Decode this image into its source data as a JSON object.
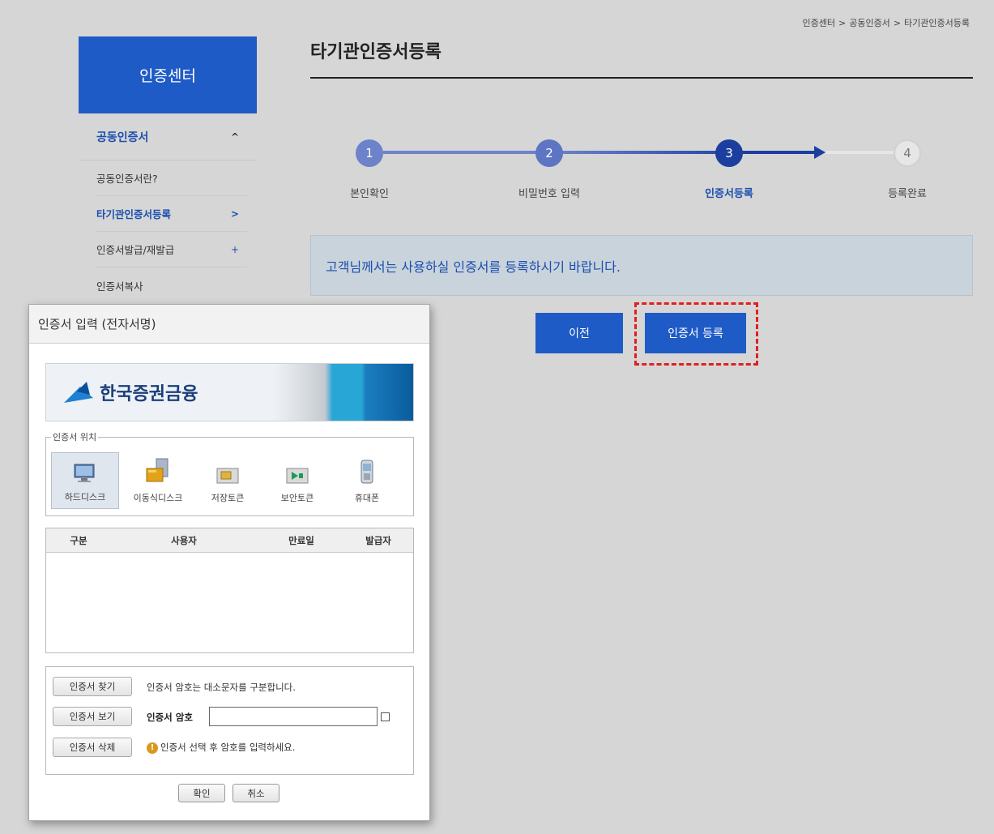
{
  "breadcrumb": [
    "인증센터",
    "공동인증서",
    "타기관인증서등록"
  ],
  "breadcrumb_separator": ">",
  "sidebar": {
    "title": "인증센터",
    "section": "공동인증서",
    "section_toggle": "^",
    "items": [
      {
        "label": "공동인증서란?",
        "mark": ""
      },
      {
        "label": "타기관인증서등록",
        "mark": ">"
      },
      {
        "label": "인증서발급/재발급",
        "mark": "+"
      },
      {
        "label": "인증서복사",
        "mark": ""
      }
    ]
  },
  "main": {
    "title": "타기관인증서등록",
    "steps": [
      {
        "num": "1",
        "label": "본인확인"
      },
      {
        "num": "2",
        "label": "비밀번호 입력"
      },
      {
        "num": "3",
        "label": "인증서등록"
      },
      {
        "num": "4",
        "label": "등록완료"
      }
    ],
    "current_step": 3,
    "notice": "고객님께서는 사용하실 인증서를 등록하시기 바랍니다.",
    "prev_button": "이전",
    "register_button": "인증서 등록"
  },
  "dialog": {
    "title": "인증서 입력 (전자서명)",
    "brand": "한국증권금융",
    "location_legend": "인증서 위치",
    "locations": [
      {
        "label": "하드디스크",
        "icon": "hard-disk-icon"
      },
      {
        "label": "이동식디스크",
        "icon": "removable-disk-icon"
      },
      {
        "label": "저장토큰",
        "icon": "storage-token-icon"
      },
      {
        "label": "보안토큰",
        "icon": "security-token-icon"
      },
      {
        "label": "휴대폰",
        "icon": "mobile-phone-icon"
      }
    ],
    "table_headers": [
      "구분",
      "사용자",
      "만료일",
      "발급자"
    ],
    "find_button": "인증서 찾기",
    "view_button": "인증서 보기",
    "delete_button": "인증서 삭제",
    "case_note": "인증서 암호는 대소문자를 구분합니다.",
    "password_label": "인증서 암호",
    "password_value": "",
    "hint": "인증서 선택 후 암호를 입력하세요.",
    "ok_button": "확인",
    "cancel_button": "취소"
  },
  "colors": {
    "primary": "#1f5bc6",
    "highlight": "#e11f1f",
    "step_done": "#6c82c9",
    "step_current": "#1c3f9f",
    "step_pending": "#e6e6e6"
  }
}
